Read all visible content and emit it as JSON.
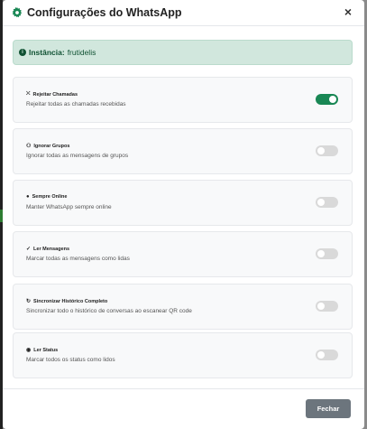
{
  "modal": {
    "title": "Configurações do WhatsApp",
    "close_symbol": "×",
    "title_icon": "gear-icon"
  },
  "alert": {
    "label": "Instância:",
    "value": "frutidelis",
    "icon": "info-icon",
    "color": "#0f5132"
  },
  "settings": [
    {
      "title": "Rejeitar Chamadas",
      "icon": "phone-off-icon",
      "icon_glyph": "⛌",
      "description": "Rejeitar todas as chamadas recebidas",
      "enabled": true
    },
    {
      "title": "Ignorar Grupos",
      "icon": "users-icon",
      "icon_glyph": "⚇",
      "description": "Ignorar todas as mensagens de grupos",
      "enabled": false
    },
    {
      "title": "Sempre Online",
      "icon": "circle-icon",
      "icon_glyph": "●",
      "description": "Manter WhatsApp sempre online",
      "enabled": false
    },
    {
      "title": "Ler Mensagens",
      "icon": "check-icon",
      "icon_glyph": "✓",
      "description": "Marcar todas as mensagens como lidas",
      "enabled": false
    },
    {
      "title": "Sincronizar Histórico Completo",
      "icon": "history-icon",
      "icon_glyph": "↻",
      "description": "Sincronizar todo o histórico de conversas ao escanear QR code",
      "enabled": false
    },
    {
      "title": "Ler Status",
      "icon": "eye-icon",
      "icon_glyph": "◉",
      "description": "Marcar todos os status como lidos",
      "enabled": false
    }
  ],
  "footer": {
    "close_label": "Fechar"
  },
  "colors": {
    "accent": "#198754",
    "toggle_off": "#d9d9d9",
    "button": "#6c757d"
  }
}
